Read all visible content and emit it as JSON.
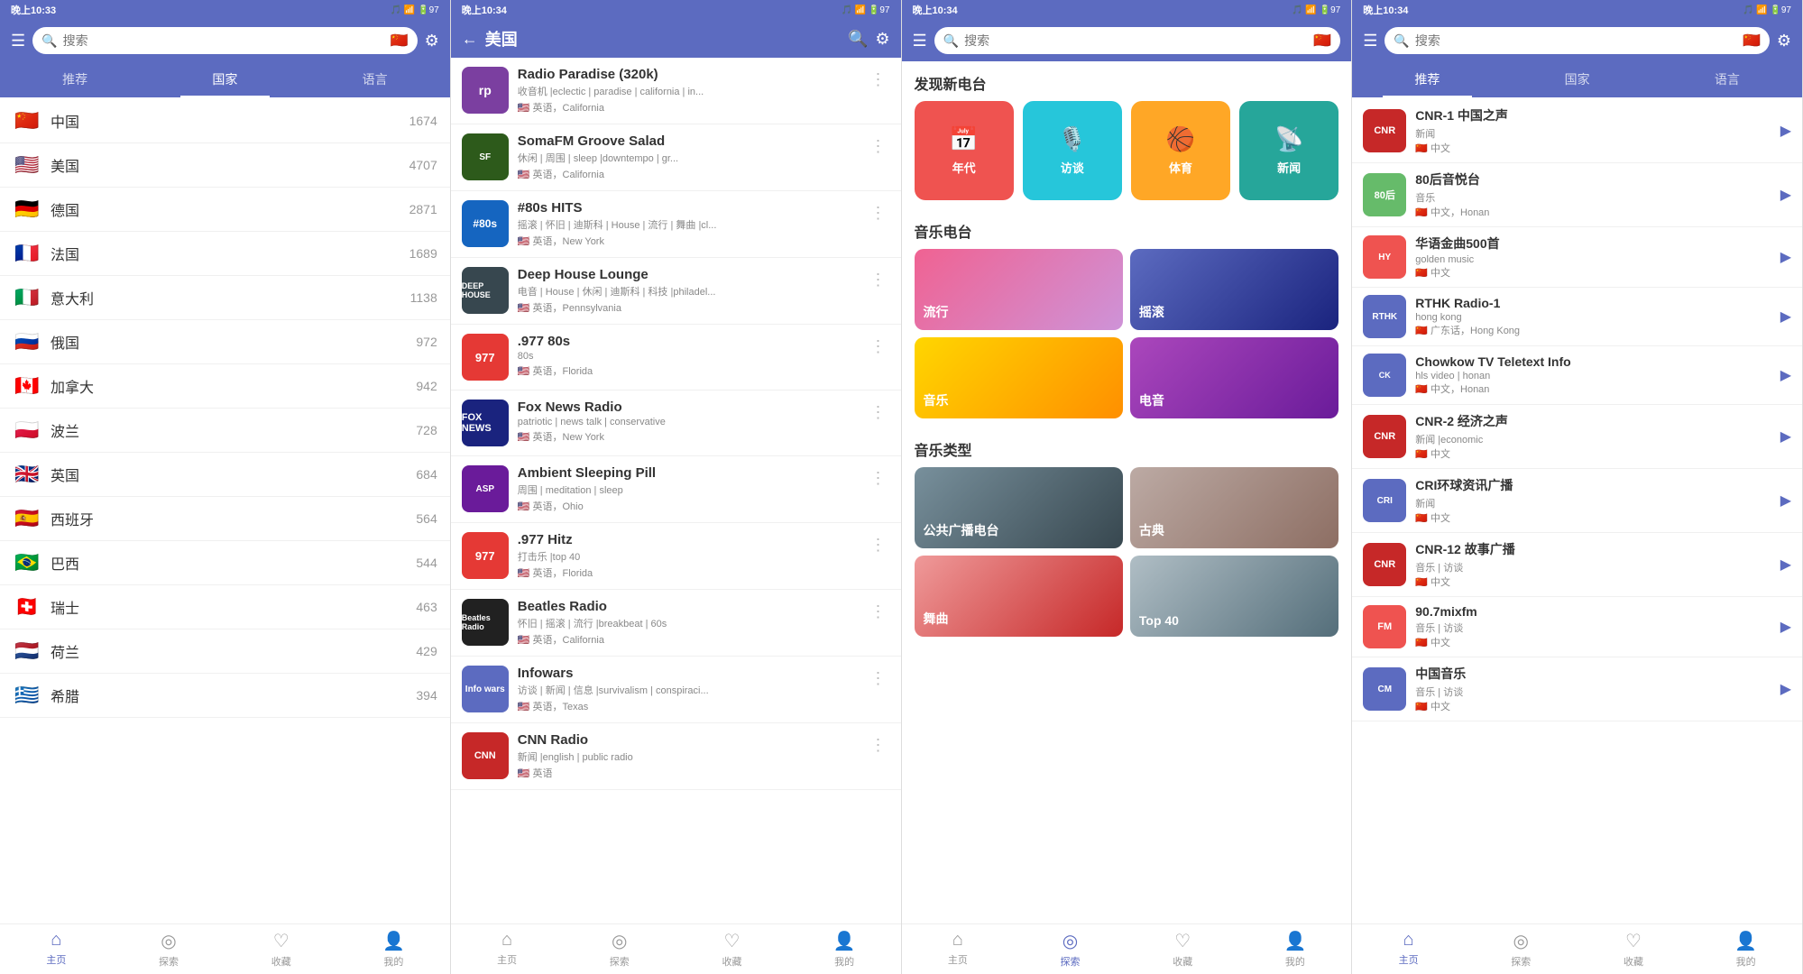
{
  "panels": [
    {
      "id": "panel1",
      "statusBar": {
        "time": "晚上10:33",
        "icons": "🎵 📶 🔋97"
      },
      "header": {
        "type": "search",
        "hasMenu": true,
        "searchPlaceholder": "搜索",
        "flagEmoji": "🇨🇳",
        "hasFilter": true
      },
      "tabs": [
        "推荐",
        "国家",
        "语言"
      ],
      "activeTab": 1,
      "countries": [
        {
          "flag": "🇨🇳",
          "name": "中国",
          "count": "1674"
        },
        {
          "flag": "🇺🇸",
          "name": "美国",
          "count": "4707"
        },
        {
          "flag": "🇩🇪",
          "name": "德国",
          "count": "2871"
        },
        {
          "flag": "🇫🇷",
          "name": "法国",
          "count": "1689"
        },
        {
          "flag": "🇮🇹",
          "name": "意大利",
          "count": "1138"
        },
        {
          "flag": "🇷🇺",
          "name": "俄国",
          "count": "972"
        },
        {
          "flag": "🇨🇦",
          "name": "加拿大",
          "count": "942"
        },
        {
          "flag": "🇵🇱",
          "name": "波兰",
          "count": "728"
        },
        {
          "flag": "🇬🇧",
          "name": "英国",
          "count": "684"
        },
        {
          "flag": "🇪🇸",
          "name": "西班牙",
          "count": "564"
        },
        {
          "flag": "🇧🇷",
          "name": "巴西",
          "count": "544"
        },
        {
          "flag": "🇨🇭",
          "name": "瑞士",
          "count": "463"
        },
        {
          "flag": "🇳🇱",
          "name": "荷兰",
          "count": "429"
        },
        {
          "flag": "🇬🇷",
          "name": "希腊",
          "count": "394"
        }
      ],
      "bottomNav": [
        {
          "icon": "⌂",
          "label": "主页",
          "active": true
        },
        {
          "icon": "◎",
          "label": "探索",
          "active": false
        },
        {
          "icon": "♡",
          "label": "收藏",
          "active": false
        },
        {
          "icon": "👤",
          "label": "我的",
          "active": false
        }
      ]
    },
    {
      "id": "panel2",
      "statusBar": {
        "time": "晚上10:34",
        "icons": "🎵 📶 🔋97"
      },
      "header": {
        "type": "back",
        "title": "美国",
        "hasSearch": true,
        "hasFilter": true
      },
      "radios": [
        {
          "name": "Radio Paradise (320k)",
          "tags": "收音机 |eclectic | paradise | california | in...",
          "lang": "英语，California",
          "color": "#7b3fa0",
          "logo": "rp"
        },
        {
          "name": "SomaFM Groove Salad",
          "tags": "休闲 | 周围 | sleep |downtempo | gr...",
          "lang": "英语，California",
          "color": "#2d5a1b",
          "logo": "SF"
        },
        {
          "name": "#80s HITS",
          "tags": "摇滚 | 怀旧 | 迪斯科 | House | 流行 | 舞曲 |cl...",
          "lang": "英语，New York",
          "color": "#1565c0",
          "logo": "80"
        },
        {
          "name": "Deep House Lounge",
          "tags": "电音 | House | 休闲 | 迪斯科 | 科技 |philadel...",
          "lang": "英语，Pennsylvania",
          "color": "#37474f",
          "logo": "DH"
        },
        {
          "name": ".977 80s",
          "tags": "80s",
          "lang": "英语，Florida",
          "color": "#e53935",
          "logo": "977"
        },
        {
          "name": "Fox News Radio",
          "tags": "patriotic | news talk | conservative",
          "lang": "英语，New York",
          "color": "#1a237e",
          "logo": "FOX"
        },
        {
          "name": "Ambient Sleeping Pill",
          "tags": "周围 | meditation | sleep",
          "lang": "英语，Ohio",
          "color": "#6a1b9a",
          "logo": "ASP"
        },
        {
          "name": ".977 Hitz",
          "tags": "打击乐 |top 40",
          "lang": "英语，Florida",
          "color": "#e53935",
          "logo": "977"
        },
        {
          "name": "Beatles Radio",
          "tags": "怀旧 | 摇滚 | 流行 |breakbeat | 60s",
          "lang": "英语，California",
          "color": "#212121",
          "logo": "BR"
        },
        {
          "name": "Infowars",
          "tags": "访谈 | 新闻 | 信息 |survivalism | conspiraci...",
          "lang": "英语，Texas",
          "color": "#5c6bc0",
          "logo": "IW"
        },
        {
          "name": "CNN Radio",
          "tags": "新闻 |english | public radio",
          "lang": "英语",
          "color": "#c62828",
          "logo": "CNN"
        }
      ],
      "bottomNav": [
        {
          "icon": "⌂",
          "label": "主页",
          "active": false
        },
        {
          "icon": "◎",
          "label": "探索",
          "active": false
        },
        {
          "icon": "♡",
          "label": "收藏",
          "active": false
        },
        {
          "icon": "👤",
          "label": "我的",
          "active": false
        }
      ]
    },
    {
      "id": "panel3",
      "statusBar": {
        "time": "晚上10:34",
        "icons": "🎵 📶 🔋97"
      },
      "header": {
        "type": "search",
        "hasMenu": true,
        "searchPlaceholder": "搜索",
        "flagEmoji": "🇨🇳",
        "hasFilter": false
      },
      "discoverTitle": "发现新电台",
      "categories": [
        {
          "label": "年代",
          "icon": "📅",
          "color": "#ef5350"
        },
        {
          "label": "访谈",
          "icon": "🎙️",
          "color": "#26c6da"
        },
        {
          "label": "体育",
          "icon": "🏀",
          "color": "#ffa726"
        },
        {
          "label": "新闻",
          "icon": "📡",
          "color": "#26a69a"
        }
      ],
      "musicTitle": "音乐电台",
      "musicCards": [
        {
          "label": "流行",
          "gradient": "linear-gradient(135deg, #f06292, #ce93d8)"
        },
        {
          "label": "摇滚",
          "gradient": "linear-gradient(135deg, #5c6bc0, #1a237e)"
        },
        {
          "label": "音乐",
          "gradient": "linear-gradient(135deg, #ffd600, #ff8f00)"
        },
        {
          "label": "电音",
          "gradient": "linear-gradient(135deg, #ab47bc, #6a1b9a)"
        }
      ],
      "musicTypeTitle": "音乐类型",
      "musicTypes": [
        {
          "label": "公共广播电台",
          "gradient": "linear-gradient(135deg, #78909c, #37474f)"
        },
        {
          "label": "古典",
          "gradient": "linear-gradient(135deg, #bcaaa4, #8d6e63)"
        },
        {
          "label": "舞曲",
          "gradient": "linear-gradient(135deg, #ef9a9a, #c62828)"
        },
        {
          "label": "Top 40",
          "gradient": "linear-gradient(135deg, #b0bec5, #546e7a)"
        }
      ],
      "bottomNav": [
        {
          "icon": "⌂",
          "label": "主页",
          "active": false
        },
        {
          "icon": "◎",
          "label": "探索",
          "active": true
        },
        {
          "icon": "♡",
          "label": "收藏",
          "active": false
        },
        {
          "icon": "👤",
          "label": "我的",
          "active": false
        }
      ]
    },
    {
      "id": "panel4",
      "statusBar": {
        "time": "晚上10:34",
        "icons": "🎵 📶 🔋97"
      },
      "header": {
        "type": "search",
        "hasMenu": true,
        "searchPlaceholder": "搜索",
        "flagEmoji": "🇨🇳",
        "hasFilter": true
      },
      "tabs": [
        "推荐",
        "国家",
        "语言"
      ],
      "activeTab": 0,
      "stations": [
        {
          "name": "CNR-1 中国之声",
          "tags": "新闻",
          "lang": "中文",
          "color": "#c62828",
          "logo": "CNR"
        },
        {
          "name": "80后音悦台",
          "tags": "音乐",
          "lang": "中文，Honan",
          "color": "#66bb6a",
          "logo": "80"
        },
        {
          "name": "华语金曲500首",
          "tags": "golden music",
          "lang": "中文",
          "color": "#ef5350",
          "logo": "HY"
        },
        {
          "name": "RTHK Radio-1",
          "tags": "hong kong",
          "lang": "广东话，Hong Kong",
          "color": "#5c6bc0",
          "logo": "RT"
        },
        {
          "name": "Chowkow TV Teletext Info",
          "tags": "hls video | honan",
          "lang": "中文，Honan",
          "color": "#5c6bc0",
          "logo": "CK"
        },
        {
          "name": "CNR-2 经济之声",
          "tags": "新闻 |economic",
          "lang": "中文",
          "color": "#c62828",
          "logo": "CNR"
        },
        {
          "name": "CRI环球资讯广播",
          "tags": "新闻",
          "lang": "中文",
          "color": "#5c6bc0",
          "logo": "CRI"
        },
        {
          "name": "CNR-12 故事广播",
          "tags": "音乐 | 访谈",
          "lang": "中文",
          "color": "#c62828",
          "logo": "CNR"
        },
        {
          "name": "90.7mixfm",
          "tags": "音乐 | 访谈",
          "lang": "中文",
          "color": "#ef5350",
          "logo": "FM"
        },
        {
          "name": "中国音乐",
          "tags": "音乐 | 访谈",
          "lang": "中文",
          "color": "#5c6bc0",
          "logo": "CM"
        }
      ],
      "bottomNav": [
        {
          "icon": "⌂",
          "label": "主页",
          "active": true
        },
        {
          "icon": "◎",
          "label": "探索",
          "active": false
        },
        {
          "icon": "♡",
          "label": "收藏",
          "active": false
        },
        {
          "icon": "👤",
          "label": "我的",
          "active": false
        }
      ]
    }
  ]
}
